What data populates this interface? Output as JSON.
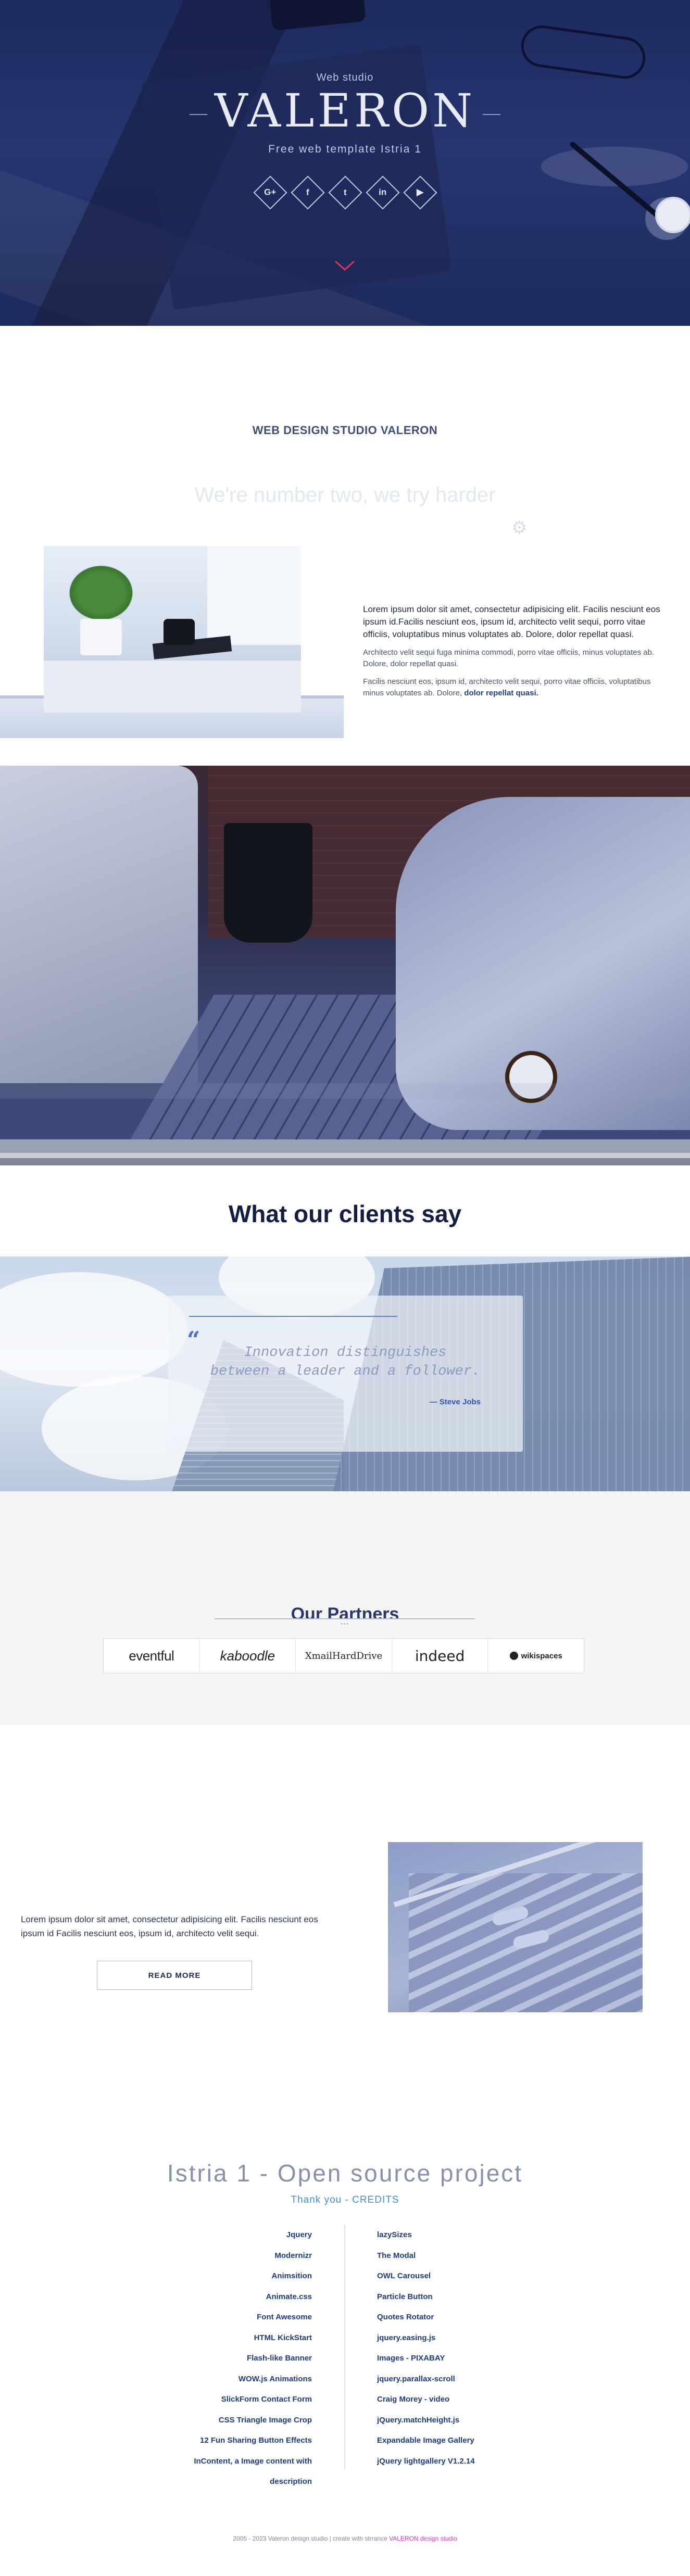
{
  "hero": {
    "subtitle": "Web studio",
    "title": "VALERON",
    "tagline": "Free web template Istria 1",
    "socials": [
      {
        "icon": "google-plus-icon",
        "glyph": "G+"
      },
      {
        "icon": "facebook-icon",
        "glyph": "f"
      },
      {
        "icon": "twitter-icon",
        "glyph": "t"
      },
      {
        "icon": "linkedin-icon",
        "glyph": "in"
      },
      {
        "icon": "youtube-icon",
        "glyph": "▶"
      }
    ]
  },
  "studio": {
    "heading": "WEB DESIGN STUDIO VALERON",
    "motto": "We're number two, we try harder",
    "p1": "Lorem ipsum dolor sit amet, consectetur adipisicing elit. Facilis nesciunt eos ipsum id.Facilis nesciunt eos, ipsum id, architecto velit sequi, porro vitae officiis, voluptatibus minus voluptates ab. Dolore, dolor repellat quasi.",
    "p2": "Architecto velit sequi fuga minima commodi, porro vitae officiis, minus voluptates ab. Dolore, dolor repellat quasi.",
    "p3": "Facilis nesciunt eos, ipsum id, architecto velit sequi, porro vitae officiis, voluptatibus minus voluptates ab. Dolore,",
    "p3_link": "dolor repellat quasi."
  },
  "clients": {
    "title": "What our clients say",
    "quote_line1": "Innovation distinguishes",
    "quote_line2": "between a leader and a follower.",
    "author": "— Steve Jobs"
  },
  "partners": {
    "title": "Our Partners",
    "dots": "•••",
    "logos": [
      "eventful",
      "kaboodle",
      "XmailHardDrive",
      "indeed",
      "wikispaces"
    ]
  },
  "promo": {
    "text": "Lorem ipsum dolor sit amet, consectetur adipisicing elit. Facilis nesciunt eos ipsum id Facilis nesciunt eos, ipsum id, architecto velit sequi.",
    "button": "READ MORE"
  },
  "credits": {
    "title": "Istria 1 - Open source project",
    "subtitle": "Thank you - CREDITS",
    "left": [
      "Jquery",
      "Modernizr",
      "Animsition",
      "Animate.css",
      "Font Awesome",
      "HTML KickStart",
      "Flash-like Banner",
      "WOW.js Animations",
      "SlickForm Contact Form",
      "CSS Triangle Image Crop",
      "12 Fun Sharing Button Effects",
      "InContent, a Image content with description"
    ],
    "right": [
      "lazySizes",
      "The Modal",
      "OWL Carousel",
      "Particle Button",
      "Quotes Rotator",
      "jquery.easing.js",
      "Images - PIXABAY",
      "jquery.parallax-scroll",
      "Craig Morey - video",
      "jQuery.matchHeight.js",
      "Expandable Image Gallery",
      "jQuery lightgallery V1.2.14"
    ]
  },
  "footer": {
    "text": "2005 - 2023 Valeron design studio | create with strrance",
    "link": "VALERON design studio"
  }
}
